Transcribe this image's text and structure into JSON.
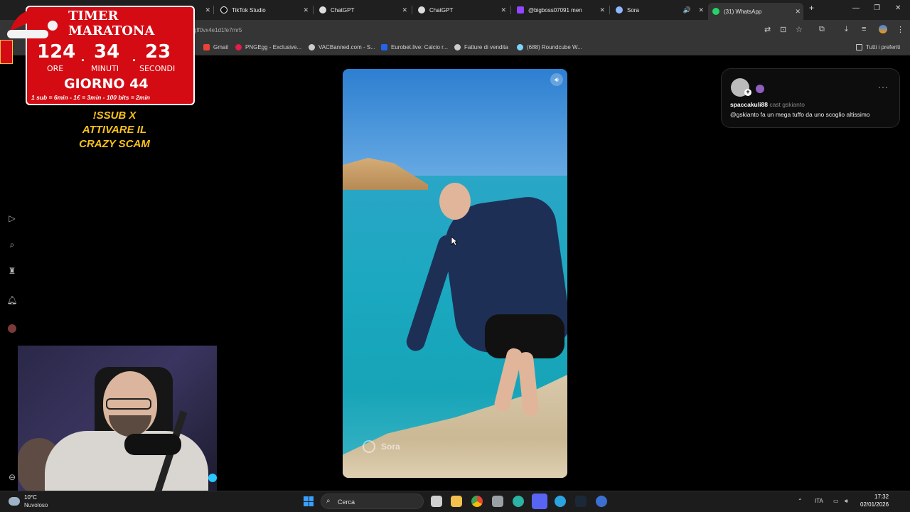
{
  "browser": {
    "tabs": [
      {
        "label": "TIMER MARATONA"
      },
      {
        "label": "TikTok Studio"
      },
      {
        "label": "ChatGPT"
      },
      {
        "label": "ChatGPT"
      },
      {
        "label": "@bigboss07091 men"
      },
      {
        "label": "Sora"
      },
      {
        "label": "(31) WhatsApp"
      }
    ],
    "url": "gff0vx4e1d1fe7mr5",
    "bookmarks": [
      {
        "label": "Gmail"
      },
      {
        "label": "PNGEgg - Exclusive..."
      },
      {
        "label": "VACBanned.com - S..."
      },
      {
        "label": "Eurobet.live: Calcio r..."
      },
      {
        "label": "Fatture di vendita"
      },
      {
        "label": "(688) Roundcube W..."
      },
      {
        "label": "Tutti i preferiti"
      }
    ]
  },
  "timer": {
    "title": "TIMER MARATONA",
    "hours": "124",
    "minutes": "34",
    "seconds": "23",
    "hours_label": "ORE",
    "minutes_label": "MINUTI",
    "seconds_label": "SECONDI",
    "day": "GIORNO 44",
    "rates": "1 sub = 6min - 1€ = 3min - 100 bits = 2min"
  },
  "overlay": {
    "line1": "!SSUB X",
    "line2": "ATTIVARE IL",
    "line3": "CRAZY SCAM"
  },
  "video": {
    "watermark": "Sora"
  },
  "post": {
    "username": "spaccakuli88",
    "meta": "cast gskianto",
    "caption": "@gskianto fa un mega tuffo da uno scoglio altissimo"
  },
  "taskbar": {
    "temperature": "10°C",
    "weather": "Nuvoloso",
    "search_placeholder": "Cerca",
    "language": "ITA",
    "time": "17:32",
    "date": "02/01/2026"
  }
}
